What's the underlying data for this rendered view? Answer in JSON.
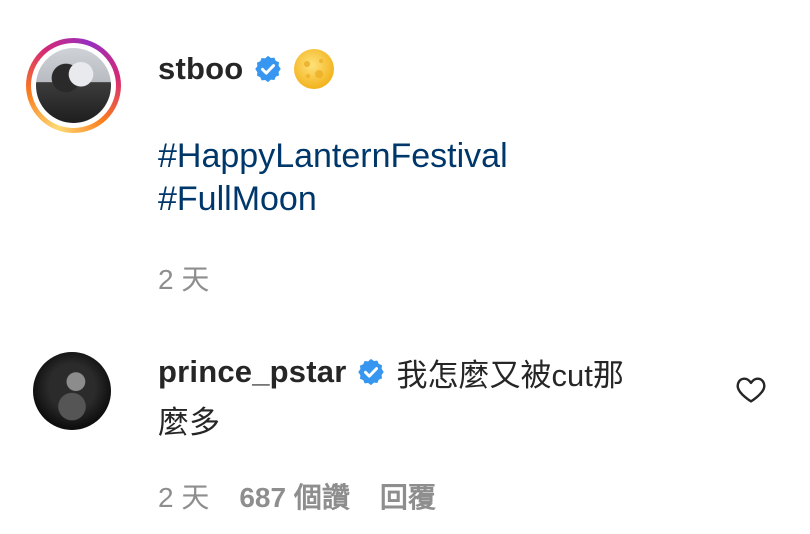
{
  "post": {
    "username": "stboo",
    "emoji": "moon-emoji",
    "hashtags": [
      "#HappyLanternFestival",
      "#FullMoon"
    ],
    "time": "2 天"
  },
  "comment": {
    "username": "prince_pstar",
    "text_line1": "我怎麼又被cut那",
    "text_line2": "麼多",
    "time": "2 天",
    "likes": "687 個讚",
    "reply": "回覆"
  },
  "colors": {
    "hashtag": "#00376b",
    "verified": "#3797f0",
    "meta": "#8e8e8e"
  }
}
